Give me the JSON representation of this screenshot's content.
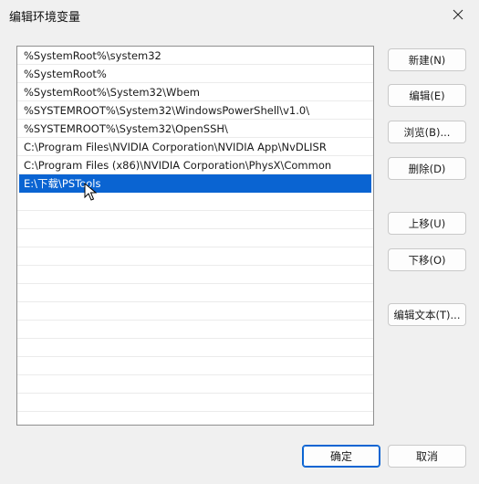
{
  "window": {
    "title": "编辑环境变量",
    "close_icon": "close-icon"
  },
  "list": {
    "items": [
      "%SystemRoot%\\system32",
      "%SystemRoot%",
      "%SystemRoot%\\System32\\Wbem",
      "%SYSTEMROOT%\\System32\\WindowsPowerShell\\v1.0\\",
      "%SYSTEMROOT%\\System32\\OpenSSH\\",
      "C:\\Program Files\\NVIDIA Corporation\\NVIDIA App\\NvDLISR",
      "C:\\Program Files (x86)\\NVIDIA Corporation\\PhysX\\Common",
      "E:\\下载\\PSTools"
    ],
    "selected_index": 7,
    "selection_color": "#0a64d2"
  },
  "buttons": {
    "new": "新建(N)",
    "edit": "编辑(E)",
    "browse": "浏览(B)...",
    "delete": "删除(D)",
    "move_up": "上移(U)",
    "move_down": "下移(O)",
    "edit_text": "编辑文本(T)...",
    "ok": "确定",
    "cancel": "取消"
  }
}
